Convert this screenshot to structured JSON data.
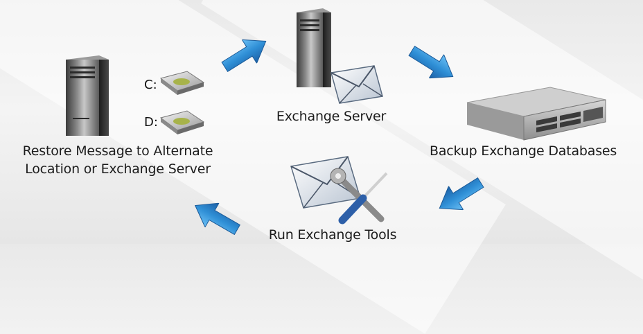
{
  "nodes": {
    "restore": {
      "label_line1": "Restore Message to Alternate",
      "label_line2": "Location or Exchange Server",
      "drives": [
        "C:",
        "D:"
      ]
    },
    "exchange_server": {
      "label": "Exchange Server"
    },
    "backup": {
      "label": "Backup Exchange Databases"
    },
    "tools": {
      "label": "Run Exchange Tools"
    }
  },
  "colors": {
    "arrow_blue": "#2f8fd6",
    "background": "#eeeeee",
    "text": "#1c1c1c"
  },
  "icons": [
    "tower-server-icon",
    "hard-drive-icon",
    "envelope-icon",
    "rack-server-icon",
    "wrench-screwdriver-icon",
    "flow-arrow-icon"
  ]
}
